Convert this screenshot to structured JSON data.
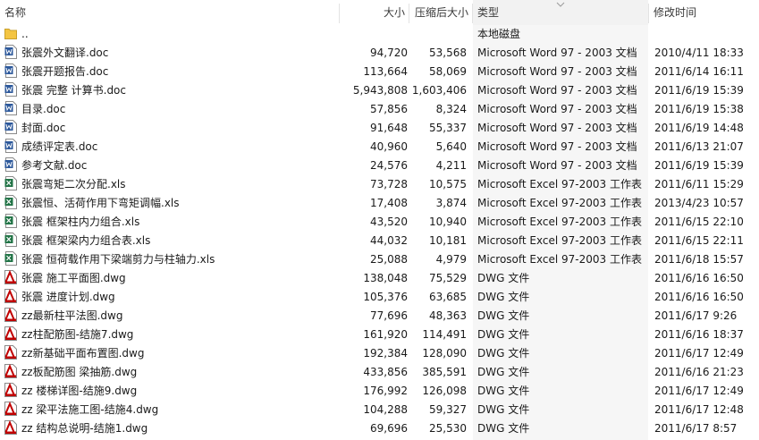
{
  "columns": {
    "name": "名称",
    "size": "大小",
    "compressed": "压缩后大小",
    "type": "类型",
    "modified": "修改时间"
  },
  "sort": {
    "column": "type",
    "direction": "descending"
  },
  "colors": {
    "word": "#2b579a",
    "excel": "#217346",
    "dwg": "#c00000",
    "folder": "#f4c542"
  },
  "rows": [
    {
      "icon": "folder-icon",
      "name": "..",
      "size": "",
      "compressed": "",
      "type": "本地磁盘",
      "modified": ""
    },
    {
      "icon": "word-doc-icon",
      "name": "张震外文翻译.doc",
      "size": "94,720",
      "compressed": "53,568",
      "type": "Microsoft Word 97 - 2003 文档",
      "modified": "2010/4/11 18:33"
    },
    {
      "icon": "word-doc-icon",
      "name": "张震开题报告.doc",
      "size": "113,664",
      "compressed": "58,069",
      "type": "Microsoft Word 97 - 2003 文档",
      "modified": "2011/6/14 16:11"
    },
    {
      "icon": "word-doc-icon",
      "name": "张震 完整 计算书.doc",
      "size": "5,943,808",
      "compressed": "1,603,406",
      "type": "Microsoft Word 97 - 2003 文档",
      "modified": "2011/6/19 15:39"
    },
    {
      "icon": "word-doc-icon",
      "name": "目录.doc",
      "size": "57,856",
      "compressed": "8,324",
      "type": "Microsoft Word 97 - 2003 文档",
      "modified": "2011/6/19 15:38"
    },
    {
      "icon": "word-doc-icon",
      "name": "封面.doc",
      "size": "91,648",
      "compressed": "55,337",
      "type": "Microsoft Word 97 - 2003 文档",
      "modified": "2011/6/19 14:48"
    },
    {
      "icon": "word-doc-icon",
      "name": "成绩评定表.doc",
      "size": "40,960",
      "compressed": "5,640",
      "type": "Microsoft Word 97 - 2003 文档",
      "modified": "2011/6/13 21:07"
    },
    {
      "icon": "word-doc-icon",
      "name": "参考文献.doc",
      "size": "24,576",
      "compressed": "4,211",
      "type": "Microsoft Word 97 - 2003 文档",
      "modified": "2011/6/19 15:39"
    },
    {
      "icon": "excel-xls-icon",
      "name": "张震弯矩二次分配.xls",
      "size": "73,728",
      "compressed": "10,575",
      "type": "Microsoft Excel 97-2003 工作表",
      "modified": "2011/6/11 15:29"
    },
    {
      "icon": "excel-xls-icon",
      "name": "张震恒、活荷作用下弯矩调幅.xls",
      "size": "17,408",
      "compressed": "3,874",
      "type": "Microsoft Excel 97-2003 工作表",
      "modified": "2013/4/23 10:57"
    },
    {
      "icon": "excel-xls-icon",
      "name": "张震 框架柱内力组合.xls",
      "size": "43,520",
      "compressed": "10,940",
      "type": "Microsoft Excel 97-2003 工作表",
      "modified": "2011/6/15 22:10"
    },
    {
      "icon": "excel-xls-icon",
      "name": "张震 框架梁内力组合表.xls",
      "size": "44,032",
      "compressed": "10,181",
      "type": "Microsoft Excel 97-2003 工作表",
      "modified": "2011/6/15 22:11"
    },
    {
      "icon": "excel-xls-icon",
      "name": "张震 恒荷载作用下梁端剪力与柱轴力.xls",
      "size": "25,088",
      "compressed": "4,979",
      "type": "Microsoft Excel 97-2003 工作表",
      "modified": "2011/6/18 15:57"
    },
    {
      "icon": "dwg-file-icon",
      "name": "张震 施工平面图.dwg",
      "size": "138,048",
      "compressed": "75,529",
      "type": "DWG 文件",
      "modified": "2011/6/16 16:50"
    },
    {
      "icon": "dwg-file-icon",
      "name": "张震 进度计划.dwg",
      "size": "105,376",
      "compressed": "63,685",
      "type": "DWG 文件",
      "modified": "2011/6/16 16:50"
    },
    {
      "icon": "dwg-file-icon",
      "name": "zz最新柱平法图.dwg",
      "size": "77,696",
      "compressed": "48,363",
      "type": "DWG 文件",
      "modified": "2011/6/17 9:26"
    },
    {
      "icon": "dwg-file-icon",
      "name": "zz柱配筋图-结施7.dwg",
      "size": "161,920",
      "compressed": "114,491",
      "type": "DWG 文件",
      "modified": "2011/6/16 18:37"
    },
    {
      "icon": "dwg-file-icon",
      "name": "zz新基础平面布置图.dwg",
      "size": "192,384",
      "compressed": "128,090",
      "type": "DWG 文件",
      "modified": "2011/6/17 12:49"
    },
    {
      "icon": "dwg-file-icon",
      "name": "zz板配筋图 梁抽筋.dwg",
      "size": "433,856",
      "compressed": "385,591",
      "type": "DWG 文件",
      "modified": "2011/6/16 21:23"
    },
    {
      "icon": "dwg-file-icon",
      "name": "zz 楼梯详图-结施9.dwg",
      "size": "176,992",
      "compressed": "126,098",
      "type": "DWG 文件",
      "modified": "2011/6/17 12:49"
    },
    {
      "icon": "dwg-file-icon",
      "name": "zz 梁平法施工图-结施4.dwg",
      "size": "104,288",
      "compressed": "59,327",
      "type": "DWG 文件",
      "modified": "2011/6/17 12:48"
    },
    {
      "icon": "dwg-file-icon",
      "name": "zz 结构总说明-结施1.dwg",
      "size": "69,696",
      "compressed": "25,530",
      "type": "DWG 文件",
      "modified": "2011/6/17 8:57"
    }
  ]
}
